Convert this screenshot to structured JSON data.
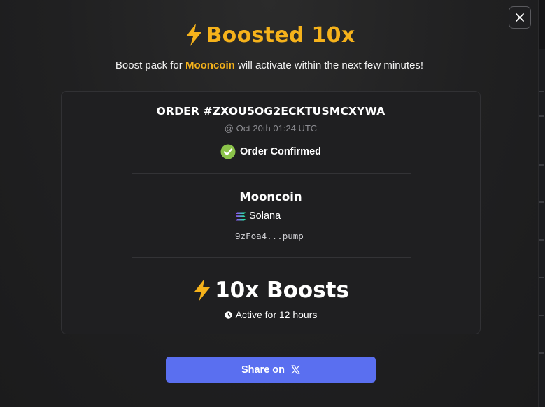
{
  "modal": {
    "title": "Boosted 10x",
    "subtitle_before": "Boost pack for ",
    "subtitle_coin": "Mooncoin",
    "subtitle_after": " will activate within the next few minutes!"
  },
  "order": {
    "id_label": "ORDER #ZXOU5OG2ECKTUSMCXYWA",
    "time": "@ Oct 20th 01:24 UTC",
    "status": "Order Confirmed"
  },
  "token": {
    "name": "Mooncoin",
    "chain": "Solana",
    "address": "9zFoa4...pump"
  },
  "boost": {
    "label": "10x Boosts",
    "duration": "Active for 12 hours"
  },
  "share": {
    "label": "Share on"
  },
  "icons": {
    "title": "lightning-icon",
    "close": "close-icon",
    "status": "check-circle-icon",
    "chain": "solana-icon",
    "duration": "clock-icon",
    "share": "x-logo-icon"
  },
  "colors": {
    "accent": "#f5b21b",
    "success": "#8bc34a",
    "button": "#5a6ff0"
  }
}
